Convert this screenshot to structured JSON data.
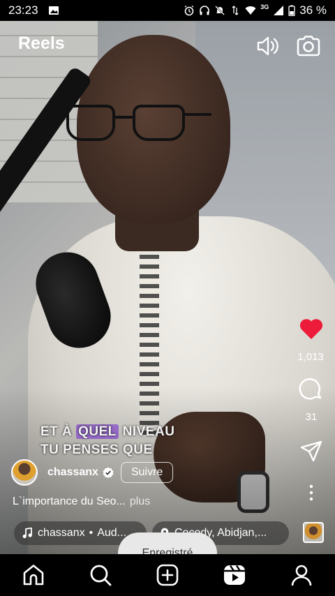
{
  "status_bar": {
    "time": "23:23",
    "network": "3G",
    "battery": "36 %"
  },
  "header": {
    "title": "Reels"
  },
  "video": {
    "subtitle_line1_pre": "ET À ",
    "subtitle_line1_highlight": "QUEL",
    "subtitle_line1_post": " NIVEAU",
    "subtitle_line2": "TU PENSES QUE"
  },
  "actions": {
    "likes": "1,013",
    "comments": "31",
    "like_color": "#ed1c3a"
  },
  "author": {
    "username": "chassanx",
    "follow_label": "Suivre"
  },
  "description": {
    "text": "L`importance du Seo...",
    "more": "plus"
  },
  "audio": {
    "artist": "chassanx",
    "separator": "•",
    "track": "Aud..."
  },
  "location": {
    "text": "Cocody, Abidjan,..."
  },
  "toast": {
    "text": "Enregistré"
  },
  "icons": {
    "sound": "speaker-icon",
    "camera": "camera-icon",
    "like": "heart-icon",
    "comment": "comment-icon",
    "share": "send-icon",
    "more": "more-vertical-icon",
    "home": "home-icon",
    "search": "search-icon",
    "create": "plus-square-icon",
    "reels": "reels-icon",
    "profile": "profile-icon"
  }
}
